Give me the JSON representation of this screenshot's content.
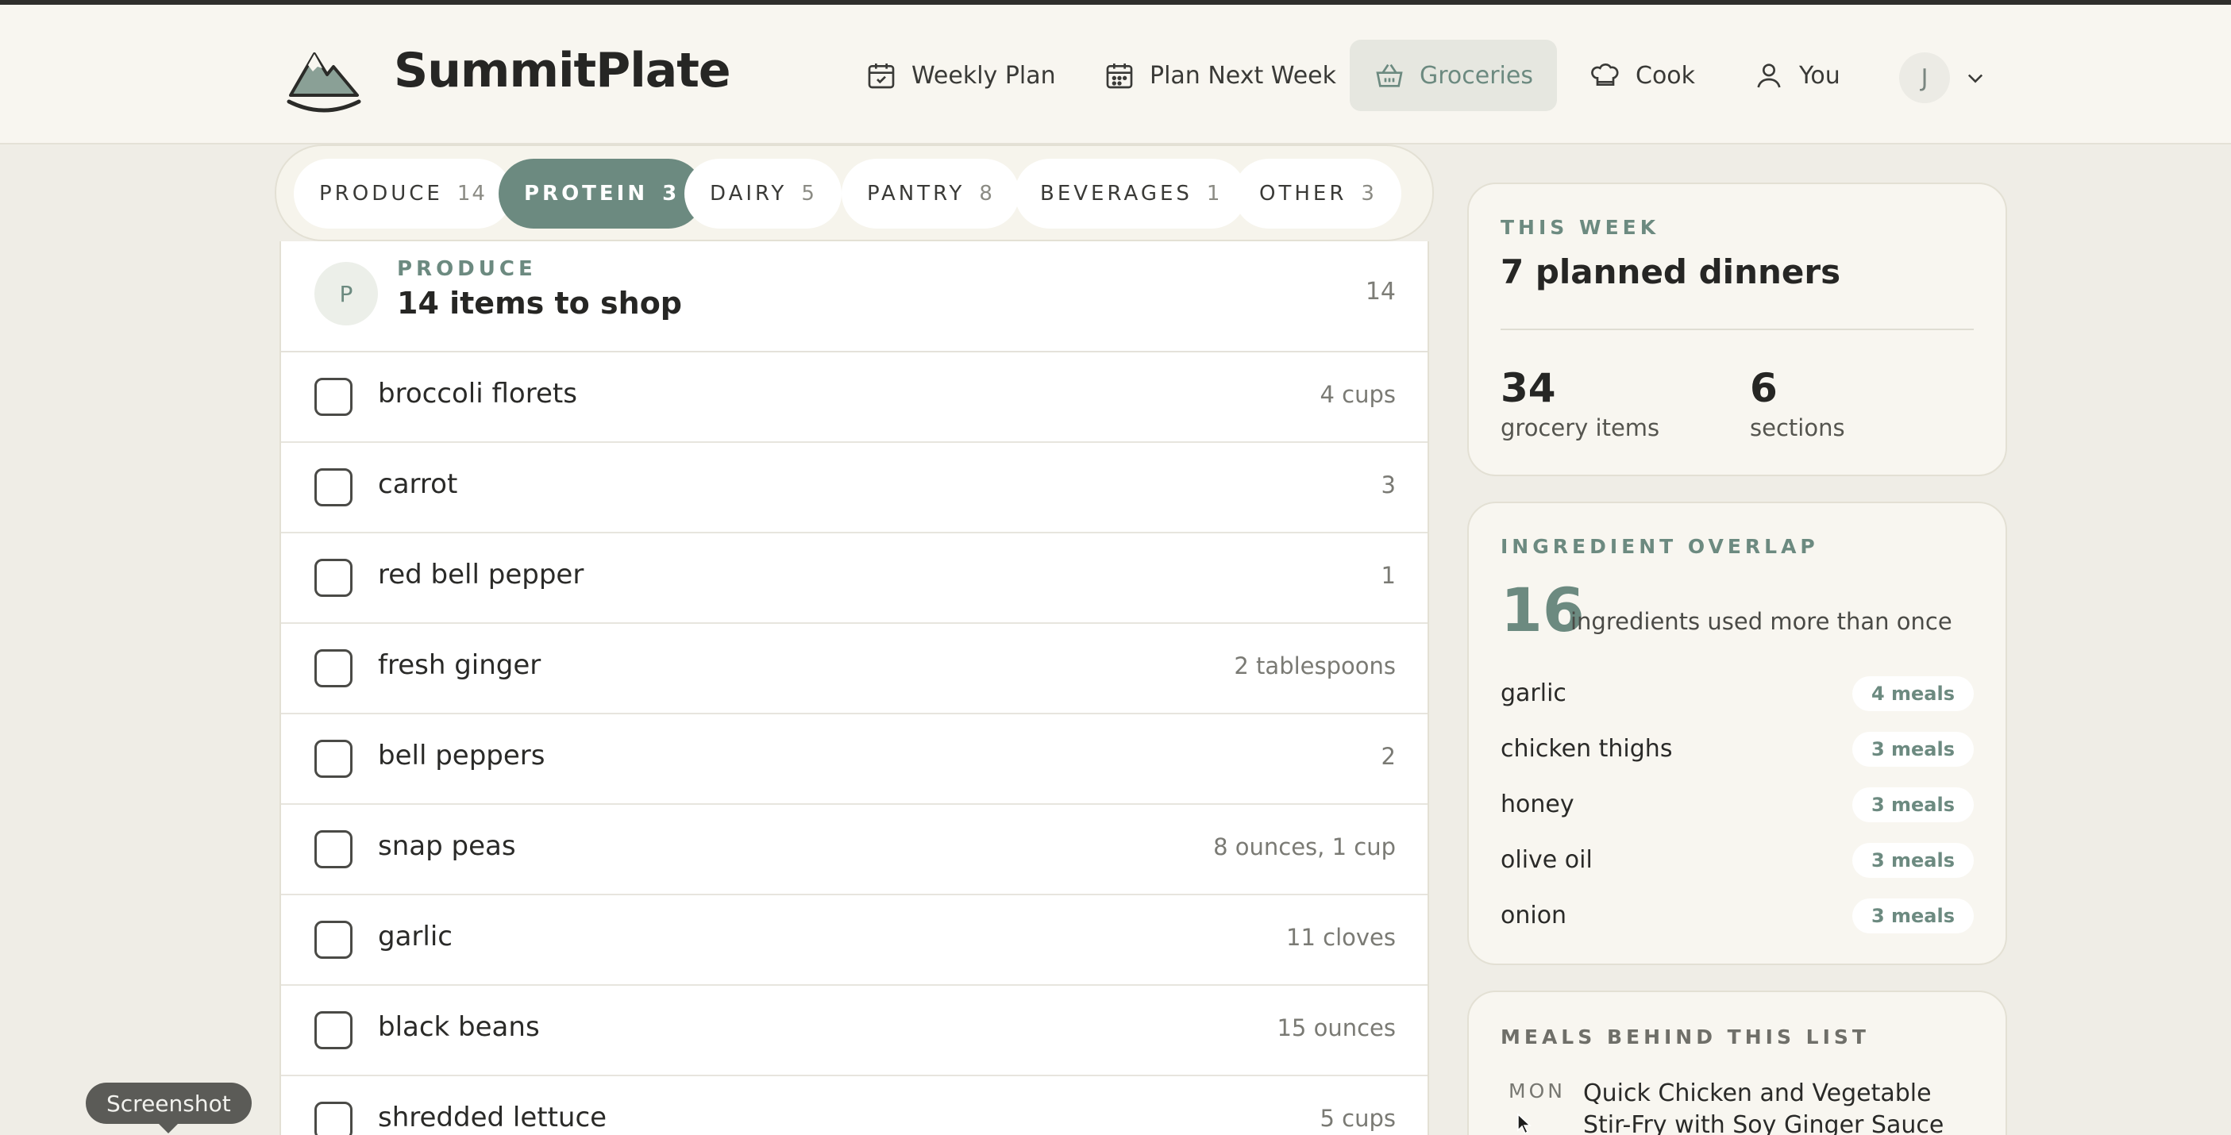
{
  "app": {
    "brand": "SummitPlate",
    "avatar_initial": "J"
  },
  "nav": {
    "weekly_plan": "Weekly Plan",
    "plan_next_week": "Plan Next Week",
    "groceries": "Groceries",
    "cook": "Cook",
    "you": "You"
  },
  "tabs": [
    {
      "label": "PRODUCE",
      "count": "14"
    },
    {
      "label": "PROTEIN",
      "count": "3"
    },
    {
      "label": "DAIRY",
      "count": "5"
    },
    {
      "label": "PANTRY",
      "count": "8"
    },
    {
      "label": "BEVERAGES",
      "count": "1"
    },
    {
      "label": "OTHER",
      "count": "3"
    }
  ],
  "section": {
    "initial": "P",
    "label": "PRODUCE",
    "title": "14 items to shop",
    "count": "14"
  },
  "items": [
    {
      "name": "broccoli florets",
      "qty": "4 cups"
    },
    {
      "name": "carrot",
      "qty": "3"
    },
    {
      "name": "red bell pepper",
      "qty": "1"
    },
    {
      "name": "fresh ginger",
      "qty": "2 tablespoons"
    },
    {
      "name": "bell peppers",
      "qty": "2"
    },
    {
      "name": "snap peas",
      "qty": "8 ounces, 1 cup"
    },
    {
      "name": "garlic",
      "qty": "11 cloves"
    },
    {
      "name": "black beans",
      "qty": "15 ounces"
    },
    {
      "name": "shredded lettuce",
      "qty": "5 cups"
    }
  ],
  "this_week": {
    "eyebrow": "THIS WEEK",
    "title": "7 planned dinners",
    "items_num": "34",
    "items_label": "grocery items",
    "sections_num": "6",
    "sections_label": "sections"
  },
  "overlap": {
    "eyebrow": "INGREDIENT OVERLAP",
    "num": "16",
    "label": "ingredients used more than once",
    "rows": [
      {
        "name": "garlic",
        "meals": "4 meals"
      },
      {
        "name": "chicken thighs",
        "meals": "3 meals"
      },
      {
        "name": "honey",
        "meals": "3 meals"
      },
      {
        "name": "olive oil",
        "meals": "3 meals"
      },
      {
        "name": "onion",
        "meals": "3 meals"
      }
    ]
  },
  "meals": {
    "eyebrow": "MEALS BEHIND THIS LIST",
    "day": "MON",
    "meal": "Quick Chicken and Vegetable Stir-Fry with Soy Ginger Sauce"
  },
  "tooltip": "Screenshot",
  "colors": {
    "accent": "#6c8a80",
    "background": "#efede6",
    "card": "#f8f6f0"
  }
}
